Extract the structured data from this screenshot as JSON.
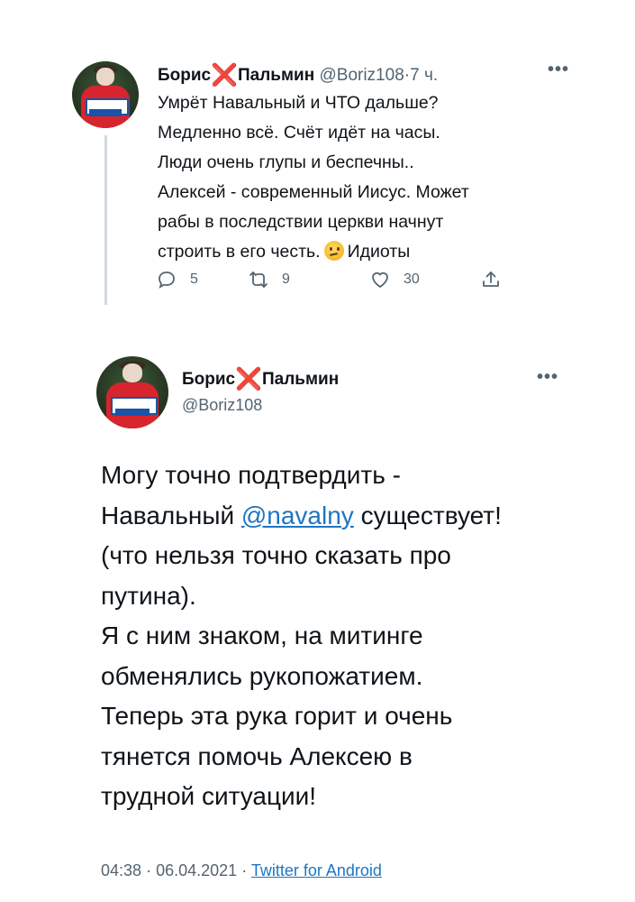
{
  "tweet1": {
    "name_first": "Борис",
    "name_x": "❌",
    "name_last": "Пальмин",
    "handle": "@Boriz108",
    "separator": "·",
    "time": "7 ч.",
    "more": "•••",
    "lines": [
      "Умрёт Навальный и ЧТО дальше?",
      "Медленно всё. Счёт идёт на часы.",
      "Люди очень глупы и беспечны..",
      "Алексей - современный Иисус. Может",
      "рабы в последствии церкви начнут",
      "строить в его честь."
    ],
    "last_word": "Идиоты",
    "emoji": "thinking-face",
    "replies": "5",
    "retweets": "9",
    "likes": "30"
  },
  "tweet2": {
    "name_first": "Борис",
    "name_x": "❌",
    "name_last": "Пальмин",
    "handle": "@Boriz108",
    "more": "•••",
    "text_1": "Могу точно подтвердить -\nНавальный ",
    "mention": "@navalny",
    "text_2": " существует!\n(что нельзя точно сказать про\nпутина).\nЯ с ним знаком, на митинге\nобменялись рукопожатием.\nТеперь эта рука горит и очень\nтянется помочь Алексею в\nтрудной ситуации!",
    "time": "04:38",
    "separator": "·",
    "date": "06.04.2021",
    "source": "Twitter for Android"
  },
  "colors": {
    "text": "#0f1419",
    "muted": "#536471",
    "link": "#1d75c4",
    "x_mark": "#e0242a"
  }
}
